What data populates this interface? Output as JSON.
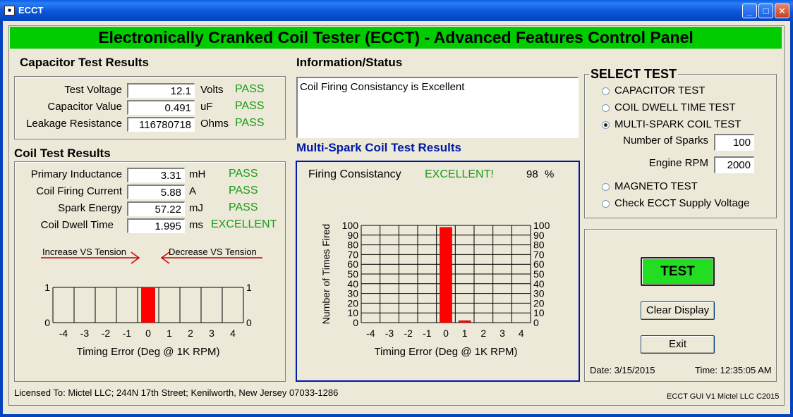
{
  "window": {
    "title": "ECCT",
    "app_icon": "window-icon",
    "buttons": [
      "minimize-icon",
      "maximize-icon",
      "close-icon"
    ]
  },
  "header": {
    "title": "Electronically Cranked Coil Tester (ECCT)  -  Advanced Features Control Panel"
  },
  "capacitor": {
    "title": "Capacitor Test Results",
    "rows": [
      {
        "label": "Test Voltage",
        "value": "12.1",
        "unit": "Volts",
        "status": "PASS"
      },
      {
        "label": "Capacitor Value",
        "value": "0.491",
        "unit": "uF",
        "status": "PASS"
      },
      {
        "label": "Leakage Resistance",
        "value": "116780718",
        "unit": "Ohms",
        "status": "PASS"
      }
    ]
  },
  "coil": {
    "title": "Coil Test Results",
    "rows": [
      {
        "label": "Primary Inductance",
        "value": "3.31",
        "unit": "mH",
        "status": "PASS"
      },
      {
        "label": "Coil Firing Current",
        "value": "5.88",
        "unit": "A",
        "status": "PASS"
      },
      {
        "label": "Spark Energy",
        "value": "57.22",
        "unit": "mJ",
        "status": "PASS"
      },
      {
        "label": "Coil Dwell Time",
        "value": "1.995",
        "unit": "ms",
        "status": "EXCELLENT"
      }
    ],
    "increase_label": "Increase VS Tension",
    "decrease_label": "Decrease VS Tension"
  },
  "info": {
    "title": "Information/Status",
    "message": "Coil Firing Consistancy is Excellent"
  },
  "multispark": {
    "title": "Multi-Spark Coil Test Results",
    "consistency_label": "Firing  Consistancy",
    "consistency_status": "EXCELLENT!",
    "consistency_value": "98",
    "consistency_unit": "%"
  },
  "select_test": {
    "title": "SELECT TEST",
    "options": [
      {
        "label": "CAPACITOR TEST",
        "checked": false
      },
      {
        "label": "COIL DWELL TIME TEST",
        "checked": false
      },
      {
        "label": "MULTI-SPARK COIL TEST",
        "checked": true
      },
      {
        "label": "MAGNETO TEST",
        "checked": false
      },
      {
        "label": "Check ECCT Supply Voltage",
        "checked": false
      }
    ],
    "num_sparks_label": "Number of Sparks",
    "num_sparks_value": "100",
    "engine_rpm_label": "Engine RPM",
    "engine_rpm_value": "2000"
  },
  "controls": {
    "test_label": "TEST",
    "clear_label": "Clear Display",
    "exit_label": "Exit",
    "date_label": "Date:  3/15/2015",
    "time_label": "Time: 12:35:05 AM"
  },
  "footer": {
    "license": "Licensed To:  Mictel LLC; 244N 17th Street; Kenilworth, New Jersey 07033-1286",
    "version": "ECCT GUI V1  Mictel LLC C2015"
  },
  "colors": {
    "header_green": "#00CC00",
    "status_green": "#1a9a1a",
    "bar_red": "#FF0000",
    "group_blue": "#0018A8"
  },
  "chart_data": [
    {
      "type": "bar",
      "categories": [
        "-4",
        "-3",
        "-2",
        "-1",
        "0",
        "1",
        "2",
        "3",
        "4"
      ],
      "values": [
        0,
        0,
        0,
        0,
        1,
        0,
        0,
        0,
        0
      ],
      "xlabel": "Timing Error (Deg @ 1K RPM)",
      "ylabel": "",
      "ylim": [
        0,
        1
      ],
      "yticks": [
        "0",
        "1"
      ],
      "grid": true
    },
    {
      "type": "bar",
      "categories": [
        "-4",
        "-3",
        "-2",
        "-1",
        "0",
        "1",
        "2",
        "3",
        "4"
      ],
      "values": [
        0,
        0,
        0,
        0,
        98,
        2,
        0,
        0,
        0
      ],
      "xlabel": "Timing Error (Deg @ 1K RPM)",
      "ylabel": "Number of Times Fired",
      "ylim": [
        0,
        100
      ],
      "yticks": [
        "0",
        "10",
        "20",
        "30",
        "40",
        "50",
        "60",
        "70",
        "80",
        "90",
        "100"
      ],
      "grid": true
    }
  ]
}
